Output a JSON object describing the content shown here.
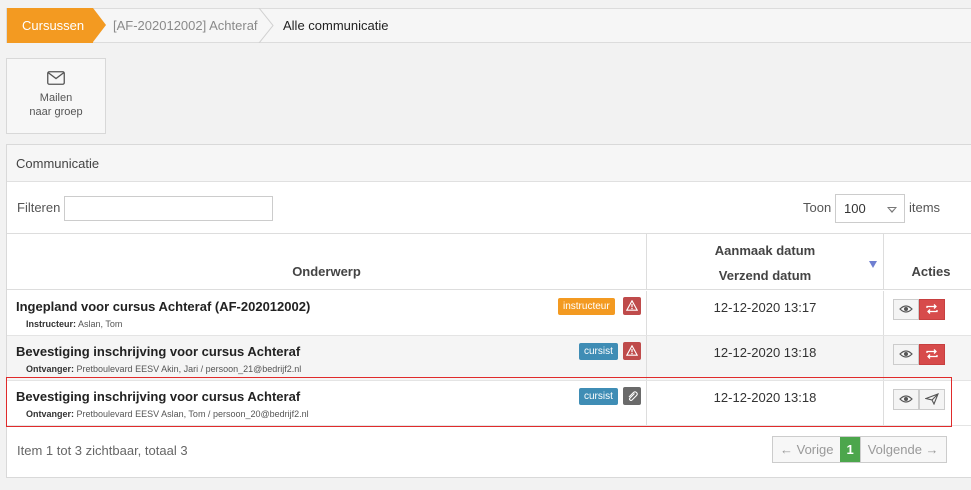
{
  "breadcrumb": {
    "items": [
      "Cursussen",
      "[AF-202012002] Achteraf",
      "Alle communicatie"
    ]
  },
  "mail_button": {
    "line1": "Mailen",
    "line2": "naar groep",
    "icon": "envelope-icon"
  },
  "panel": {
    "title": "Communicatie"
  },
  "filter": {
    "label": "Filteren",
    "value": "",
    "placeholder": ""
  },
  "page_size": {
    "label_before": "Toon",
    "value": "100",
    "label_after": "items"
  },
  "table": {
    "headers": {
      "subject": "Onderwerp",
      "created": "Aanmaak datum",
      "sent": "Verzend datum",
      "actions": "Acties"
    },
    "rows": [
      {
        "title": "Ingepland voor cursus Achteraf (AF-202012002)",
        "recipient_label": "Instructeur:",
        "recipient": "Aslan, Tom",
        "badge": "instructeur",
        "badge_color": "#f39a21",
        "flag_icon": "warning-icon",
        "date": "12-12-2020 13:17",
        "second_action_icon": "resend-icon"
      },
      {
        "title": "Bevestiging inschrijving voor cursus Achteraf",
        "recipient_label": "Ontvanger:",
        "recipient": "Pretboulevard EESV Akin, Jari / persoon_21@bedrijf2.nl",
        "badge": "cursist",
        "badge_color": "#3f8db5",
        "flag_icon": "warning-icon",
        "date": "12-12-2020 13:18",
        "second_action_icon": "resend-icon"
      },
      {
        "title": "Bevestiging inschrijving voor cursus Achteraf",
        "recipient_label": "Ontvanger:",
        "recipient": "Pretboulevard EESV Aslan, Tom / persoon_20@bedrijf2.nl",
        "badge": "cursist",
        "badge_color": "#3f8db5",
        "flag_icon": "paperclip-icon",
        "date": "12-12-2020 13:18",
        "second_action_icon": "send-icon"
      }
    ]
  },
  "footer": {
    "info": "Item 1 tot 3 zichtbaar, totaal 3",
    "prev": "← Vorige",
    "current": "1",
    "next": "Volgende →"
  }
}
